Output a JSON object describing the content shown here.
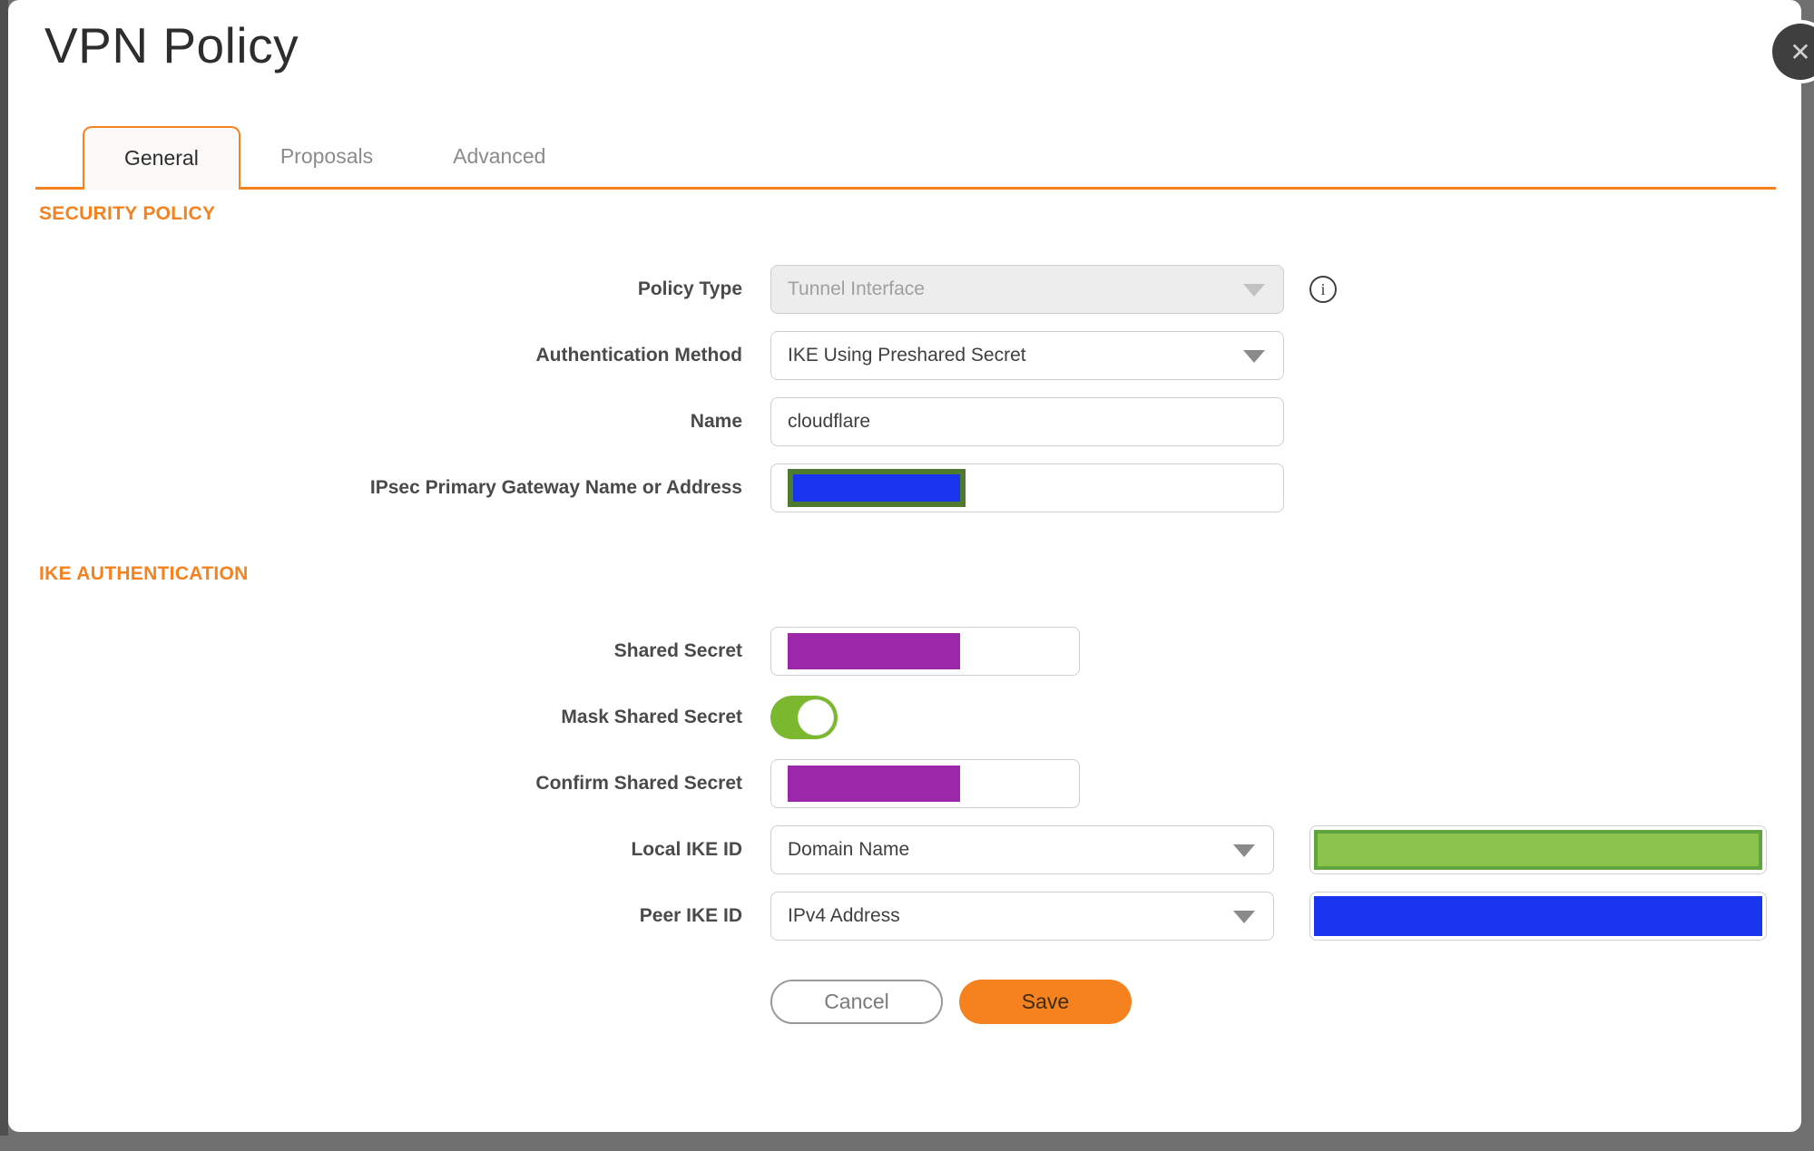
{
  "dialog": {
    "title": "VPN Policy",
    "close_icon": "✕"
  },
  "tabs": [
    {
      "label": "General",
      "active": true
    },
    {
      "label": "Proposals",
      "active": false
    },
    {
      "label": "Advanced",
      "active": false
    }
  ],
  "sections": {
    "security_policy": "SECURITY POLICY",
    "ike_authentication": "IKE AUTHENTICATION"
  },
  "fields": {
    "policy_type": {
      "label": "Policy Type",
      "value": "Tunnel Interface",
      "disabled": true,
      "info_icon": "i"
    },
    "authentication_method": {
      "label": "Authentication Method",
      "value": "IKE Using Preshared Secret"
    },
    "name": {
      "label": "Name",
      "value": "cloudflare"
    },
    "gateway": {
      "label": "IPsec Primary Gateway Name or Address",
      "value_redacted": true
    },
    "shared_secret": {
      "label": "Shared Secret",
      "value_redacted": true
    },
    "mask_shared_secret": {
      "label": "Mask Shared Secret",
      "state": "on"
    },
    "confirm_shared_secret": {
      "label": "Confirm Shared Secret",
      "value_redacted": true
    },
    "local_ike_id": {
      "label": "Local IKE ID",
      "value": "Domain Name",
      "id_value_redacted": true
    },
    "peer_ike_id": {
      "label": "Peer IKE ID",
      "value": "IPv4 Address",
      "id_value_redacted": true
    }
  },
  "buttons": {
    "cancel": "Cancel",
    "save": "Save"
  },
  "colors": {
    "accent": "#F6821F",
    "toggle_green": "#7cb82f",
    "purple": "#9c27a8",
    "blue": "#1a35f0",
    "green_fill": "#8cc34f",
    "green_border": "#5fa43c",
    "olive_border": "#4d7a2f",
    "chrome_bg": "#6f6f6f",
    "chrome_edge": "#4f4f4f"
  }
}
